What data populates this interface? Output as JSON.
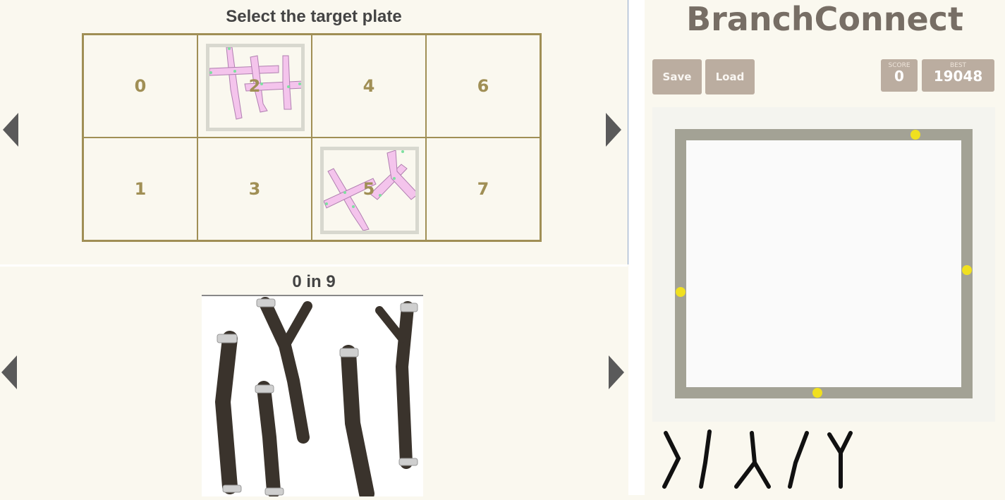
{
  "plate_selector": {
    "title": "Select the target plate",
    "cells": [
      {
        "label": "0"
      },
      {
        "label": "2"
      },
      {
        "label": "4"
      },
      {
        "label": "6"
      },
      {
        "label": "1"
      },
      {
        "label": "3"
      },
      {
        "label": "5"
      },
      {
        "label": "7"
      }
    ]
  },
  "branch_viewer": {
    "title": "0 in 9"
  },
  "game": {
    "title": "BranchConnect",
    "save_label": "Save",
    "load_label": "Load",
    "score_label": "SCORE",
    "score_value": "0",
    "best_label": "BEST",
    "best_value": "19048"
  },
  "colors": {
    "accent_gold": "#a08f55",
    "button_bg": "#bbada0",
    "board_frame": "#a3a295",
    "connector_dot": "#f0e020",
    "branch_pink": "#f4c4ec"
  },
  "icons": [
    "arrow-left-icon",
    "arrow-right-icon"
  ]
}
